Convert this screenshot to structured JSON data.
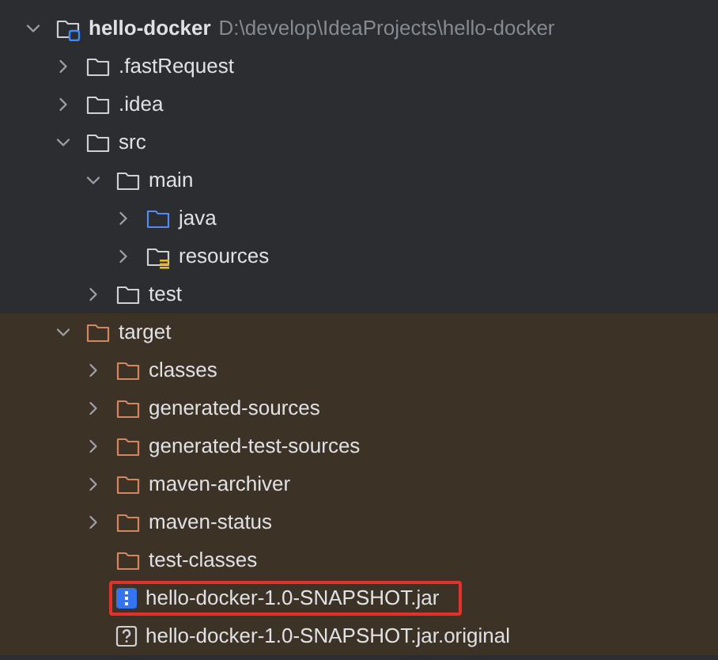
{
  "project_tree": {
    "root": {
      "name": "hello-docker",
      "path": "D:\\develop\\IdeaProjects\\hello-docker",
      "kind": "module",
      "expanded": true,
      "excluded": false,
      "highlighted": false,
      "children": [
        {
          "name": ".fastRequest",
          "kind": "folder",
          "expanded": false,
          "excluded": false,
          "highlighted": false
        },
        {
          "name": ".idea",
          "kind": "folder",
          "expanded": false,
          "excluded": false,
          "highlighted": false
        },
        {
          "name": "src",
          "kind": "folder",
          "expanded": true,
          "excluded": false,
          "highlighted": false,
          "children": [
            {
              "name": "main",
              "kind": "folder",
              "expanded": true,
              "excluded": false,
              "highlighted": false,
              "children": [
                {
                  "name": "java",
                  "kind": "source-folder",
                  "expanded": false,
                  "excluded": false,
                  "highlighted": false
                },
                {
                  "name": "resources",
                  "kind": "resource-folder",
                  "expanded": false,
                  "excluded": false,
                  "highlighted": false
                }
              ]
            },
            {
              "name": "test",
              "kind": "folder",
              "expanded": false,
              "excluded": false,
              "highlighted": false
            }
          ]
        },
        {
          "name": "target",
          "kind": "folder",
          "expanded": true,
          "excluded": true,
          "highlighted": false,
          "children": [
            {
              "name": "classes",
              "kind": "folder",
              "expanded": false,
              "excluded": true,
              "highlighted": false
            },
            {
              "name": "generated-sources",
              "kind": "folder",
              "expanded": false,
              "excluded": true,
              "highlighted": false
            },
            {
              "name": "generated-test-sources",
              "kind": "folder",
              "expanded": false,
              "excluded": true,
              "highlighted": false
            },
            {
              "name": "maven-archiver",
              "kind": "folder",
              "expanded": false,
              "excluded": true,
              "highlighted": false
            },
            {
              "name": "maven-status",
              "kind": "folder",
              "expanded": false,
              "excluded": true,
              "highlighted": false
            },
            {
              "name": "test-classes",
              "kind": "folder",
              "excluded": true,
              "highlighted": false
            },
            {
              "name": "hello-docker-1.0-SNAPSHOT.jar",
              "kind": "jar",
              "excluded": true,
              "highlighted": true
            },
            {
              "name": "hello-docker-1.0-SNAPSHOT.jar.original",
              "kind": "unknown-file",
              "excluded": true,
              "highlighted": false
            }
          ]
        }
      ]
    }
  }
}
